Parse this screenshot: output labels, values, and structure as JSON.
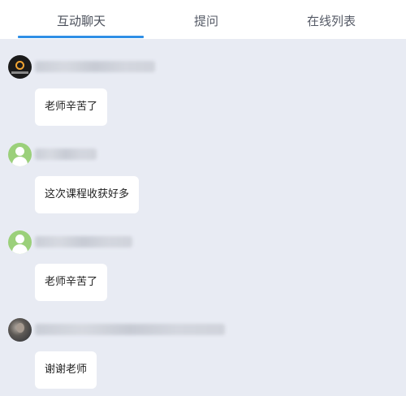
{
  "tabs": [
    {
      "label": "互动聊天",
      "active": true
    },
    {
      "label": "提问",
      "active": false
    },
    {
      "label": "在线列表",
      "active": false
    }
  ],
  "colors": {
    "accent": "#2f8fe6",
    "background": "#e8ebf3",
    "bubble": "#ffffff",
    "default_avatar": "#9bd07a"
  },
  "messages": [
    {
      "avatar": "logo-avatar",
      "text": "老师辛苦了"
    },
    {
      "avatar": "default-avatar",
      "text": "这次课程收获好多"
    },
    {
      "avatar": "default-avatar",
      "text": "老师辛苦了"
    },
    {
      "avatar": "photo-avatar",
      "text": "谢谢老师"
    }
  ]
}
